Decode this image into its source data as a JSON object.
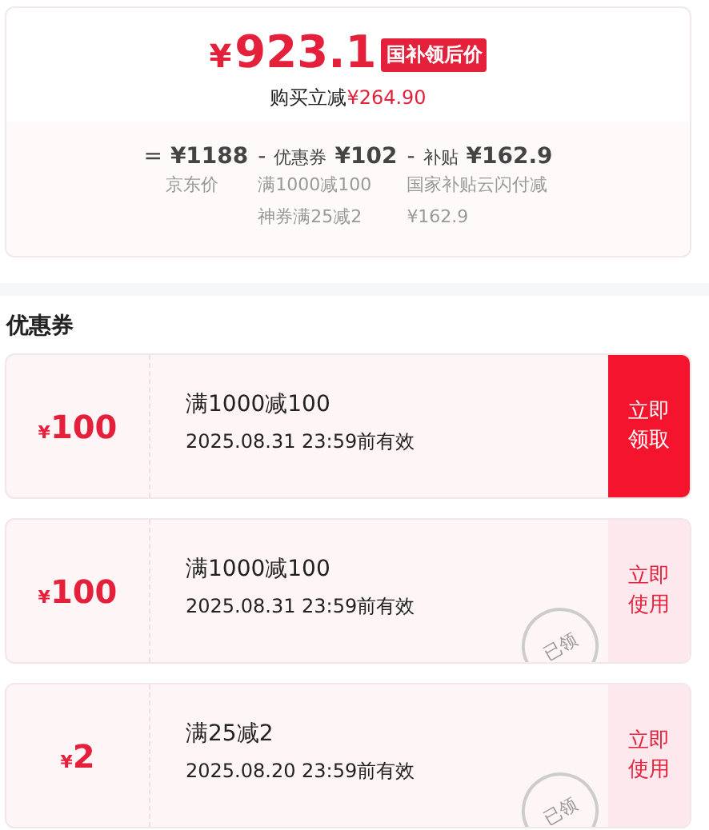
{
  "price": {
    "currency": "¥",
    "amount": "923.1",
    "badge": "国补领后价",
    "saving_label": "购买立减",
    "saving_value": "¥264.90"
  },
  "breakdown": [
    {
      "operator": "=",
      "value": "¥1188",
      "notes": [
        "京东价"
      ]
    },
    {
      "operator": "-",
      "label": "优惠券",
      "value": "¥102",
      "notes": [
        "满1000减100",
        "神券满25减2"
      ]
    },
    {
      "operator": "-",
      "label": "补贴",
      "value": "¥162.9",
      "notes": [
        "国家补贴云闪付减",
        "¥162.9"
      ]
    }
  ],
  "coupons_title": "优惠券",
  "coupons": [
    {
      "currency": "¥",
      "amount": "100",
      "title": "满1000减100",
      "validity": "2025.08.31 23:59前有效",
      "kind": "claim",
      "action": "立即领取"
    },
    {
      "currency": "¥",
      "amount": "100",
      "title": "满1000减100",
      "validity": "2025.08.31 23:59前有效",
      "kind": "use",
      "action": "立即使用",
      "stamp": "已领"
    },
    {
      "currency": "¥",
      "amount": "2",
      "title": "满25减2",
      "validity": "2025.08.20 23:59前有效",
      "kind": "use",
      "action": "立即使用",
      "stamp": "已领"
    }
  ]
}
